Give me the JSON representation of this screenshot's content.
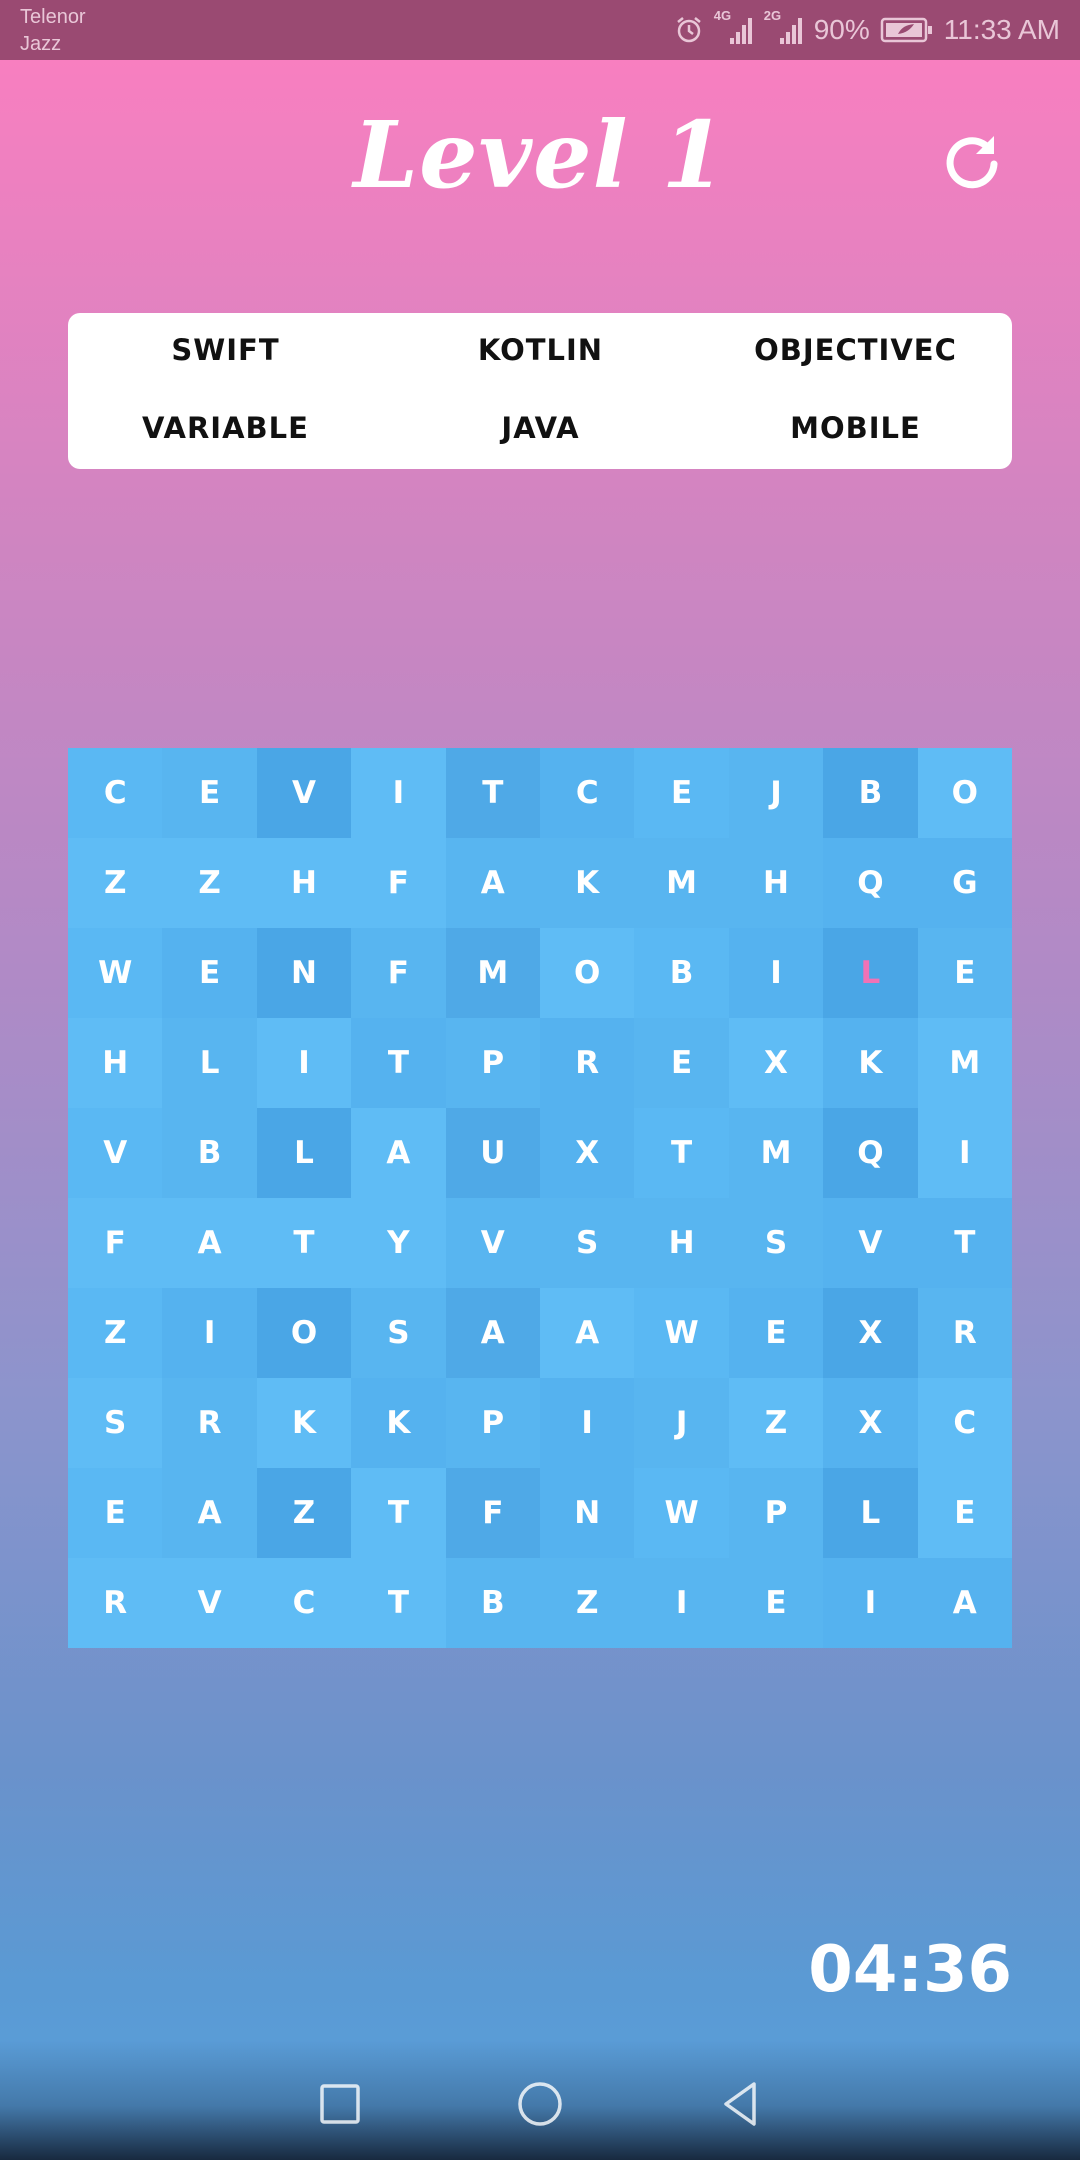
{
  "status_bar": {
    "carrier_line1": "Telenor",
    "carrier_line2": "Jazz",
    "network_4g": "4G",
    "network_2g": "2G",
    "battery": "90%",
    "time": "11:33 AM"
  },
  "header": {
    "title": "Level 1"
  },
  "words": [
    "SWIFT",
    "KOTLIN",
    "OBJECTIVEC",
    "VARIABLE",
    "JAVA",
    "MOBILE"
  ],
  "grid": [
    [
      "C",
      "E",
      "V",
      "I",
      "T",
      "C",
      "E",
      "J",
      "B",
      "O"
    ],
    [
      "Z",
      "Z",
      "H",
      "F",
      "A",
      "K",
      "M",
      "H",
      "Q",
      "G"
    ],
    [
      "W",
      "E",
      "N",
      "F",
      "M",
      "O",
      "B",
      "I",
      "L",
      "E"
    ],
    [
      "H",
      "L",
      "I",
      "T",
      "P",
      "R",
      "E",
      "X",
      "K",
      "M"
    ],
    [
      "V",
      "B",
      "L",
      "A",
      "U",
      "X",
      "T",
      "M",
      "Q",
      "I"
    ],
    [
      "F",
      "A",
      "T",
      "Y",
      "V",
      "S",
      "H",
      "S",
      "V",
      "T"
    ],
    [
      "Z",
      "I",
      "O",
      "S",
      "A",
      "A",
      "W",
      "E",
      "X",
      "R"
    ],
    [
      "S",
      "R",
      "K",
      "K",
      "P",
      "I",
      "J",
      "Z",
      "X",
      "C"
    ],
    [
      "E",
      "A",
      "Z",
      "T",
      "F",
      "N",
      "W",
      "P",
      "L",
      "E"
    ],
    [
      "R",
      "V",
      "C",
      "T",
      "B",
      "Z",
      "I",
      "E",
      "I",
      "A"
    ]
  ],
  "highlighted_cell": {
    "row": 2,
    "col": 8
  },
  "cell_colors": [
    "#5ab8f3",
    "#55b2ef",
    "#4fa9e7",
    "#5fbcf5",
    "#4aa6e6",
    "#58b5f0"
  ],
  "highlight_color": "#f072b6",
  "timer": "04:36"
}
